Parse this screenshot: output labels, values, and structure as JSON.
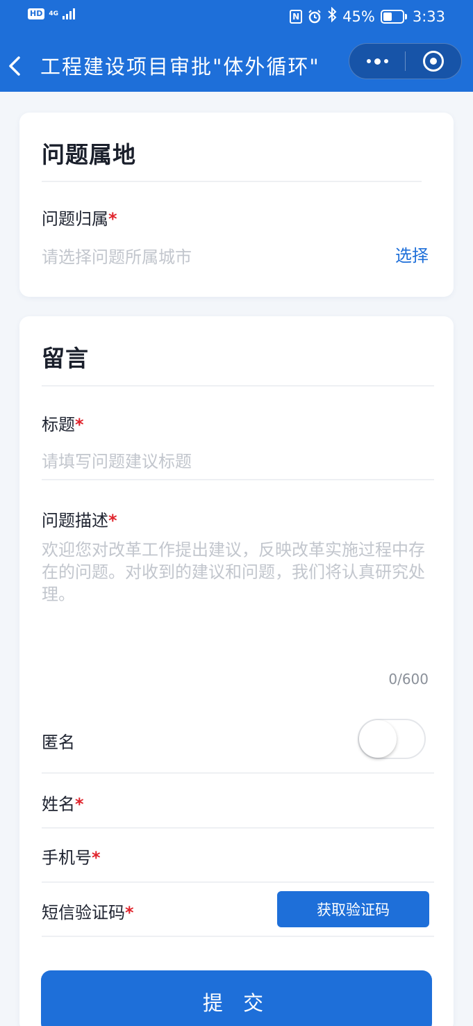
{
  "status_bar": {
    "hd": "HD",
    "network": "4G",
    "nfc": "N",
    "battery_percent": "45%",
    "battery_level": 0.45,
    "time": "3:33"
  },
  "navbar": {
    "title": "工程建设项目审批\"体外循环\""
  },
  "location_card": {
    "title": "问题属地",
    "field_label": "问题归属",
    "required_mark": "*",
    "placeholder": "请选择问题所属城市",
    "select_label": "选择"
  },
  "message_card": {
    "title": "留言",
    "subject_label": "标题",
    "subject_placeholder": "请填写问题建议标题",
    "description_label": "问题描述",
    "description_placeholder": "欢迎您对改革工作提出建议，反映改革实施过程中存在的问题。对收到的建议和问题，我们将认真研究处理。",
    "char_counter": "0/600",
    "anonymous_label": "匿名",
    "anonymous_on": false,
    "name_label": "姓名",
    "phone_label": "手机号",
    "sms_code_label": "短信验证码",
    "get_code_button": "获取验证码",
    "required_mark": "*",
    "submit_button": "提 交"
  },
  "colors": {
    "primary": "#1e6fd9",
    "required": "#e0242c",
    "background": "#f3f6fa",
    "placeholder": "#c2c6cd"
  }
}
